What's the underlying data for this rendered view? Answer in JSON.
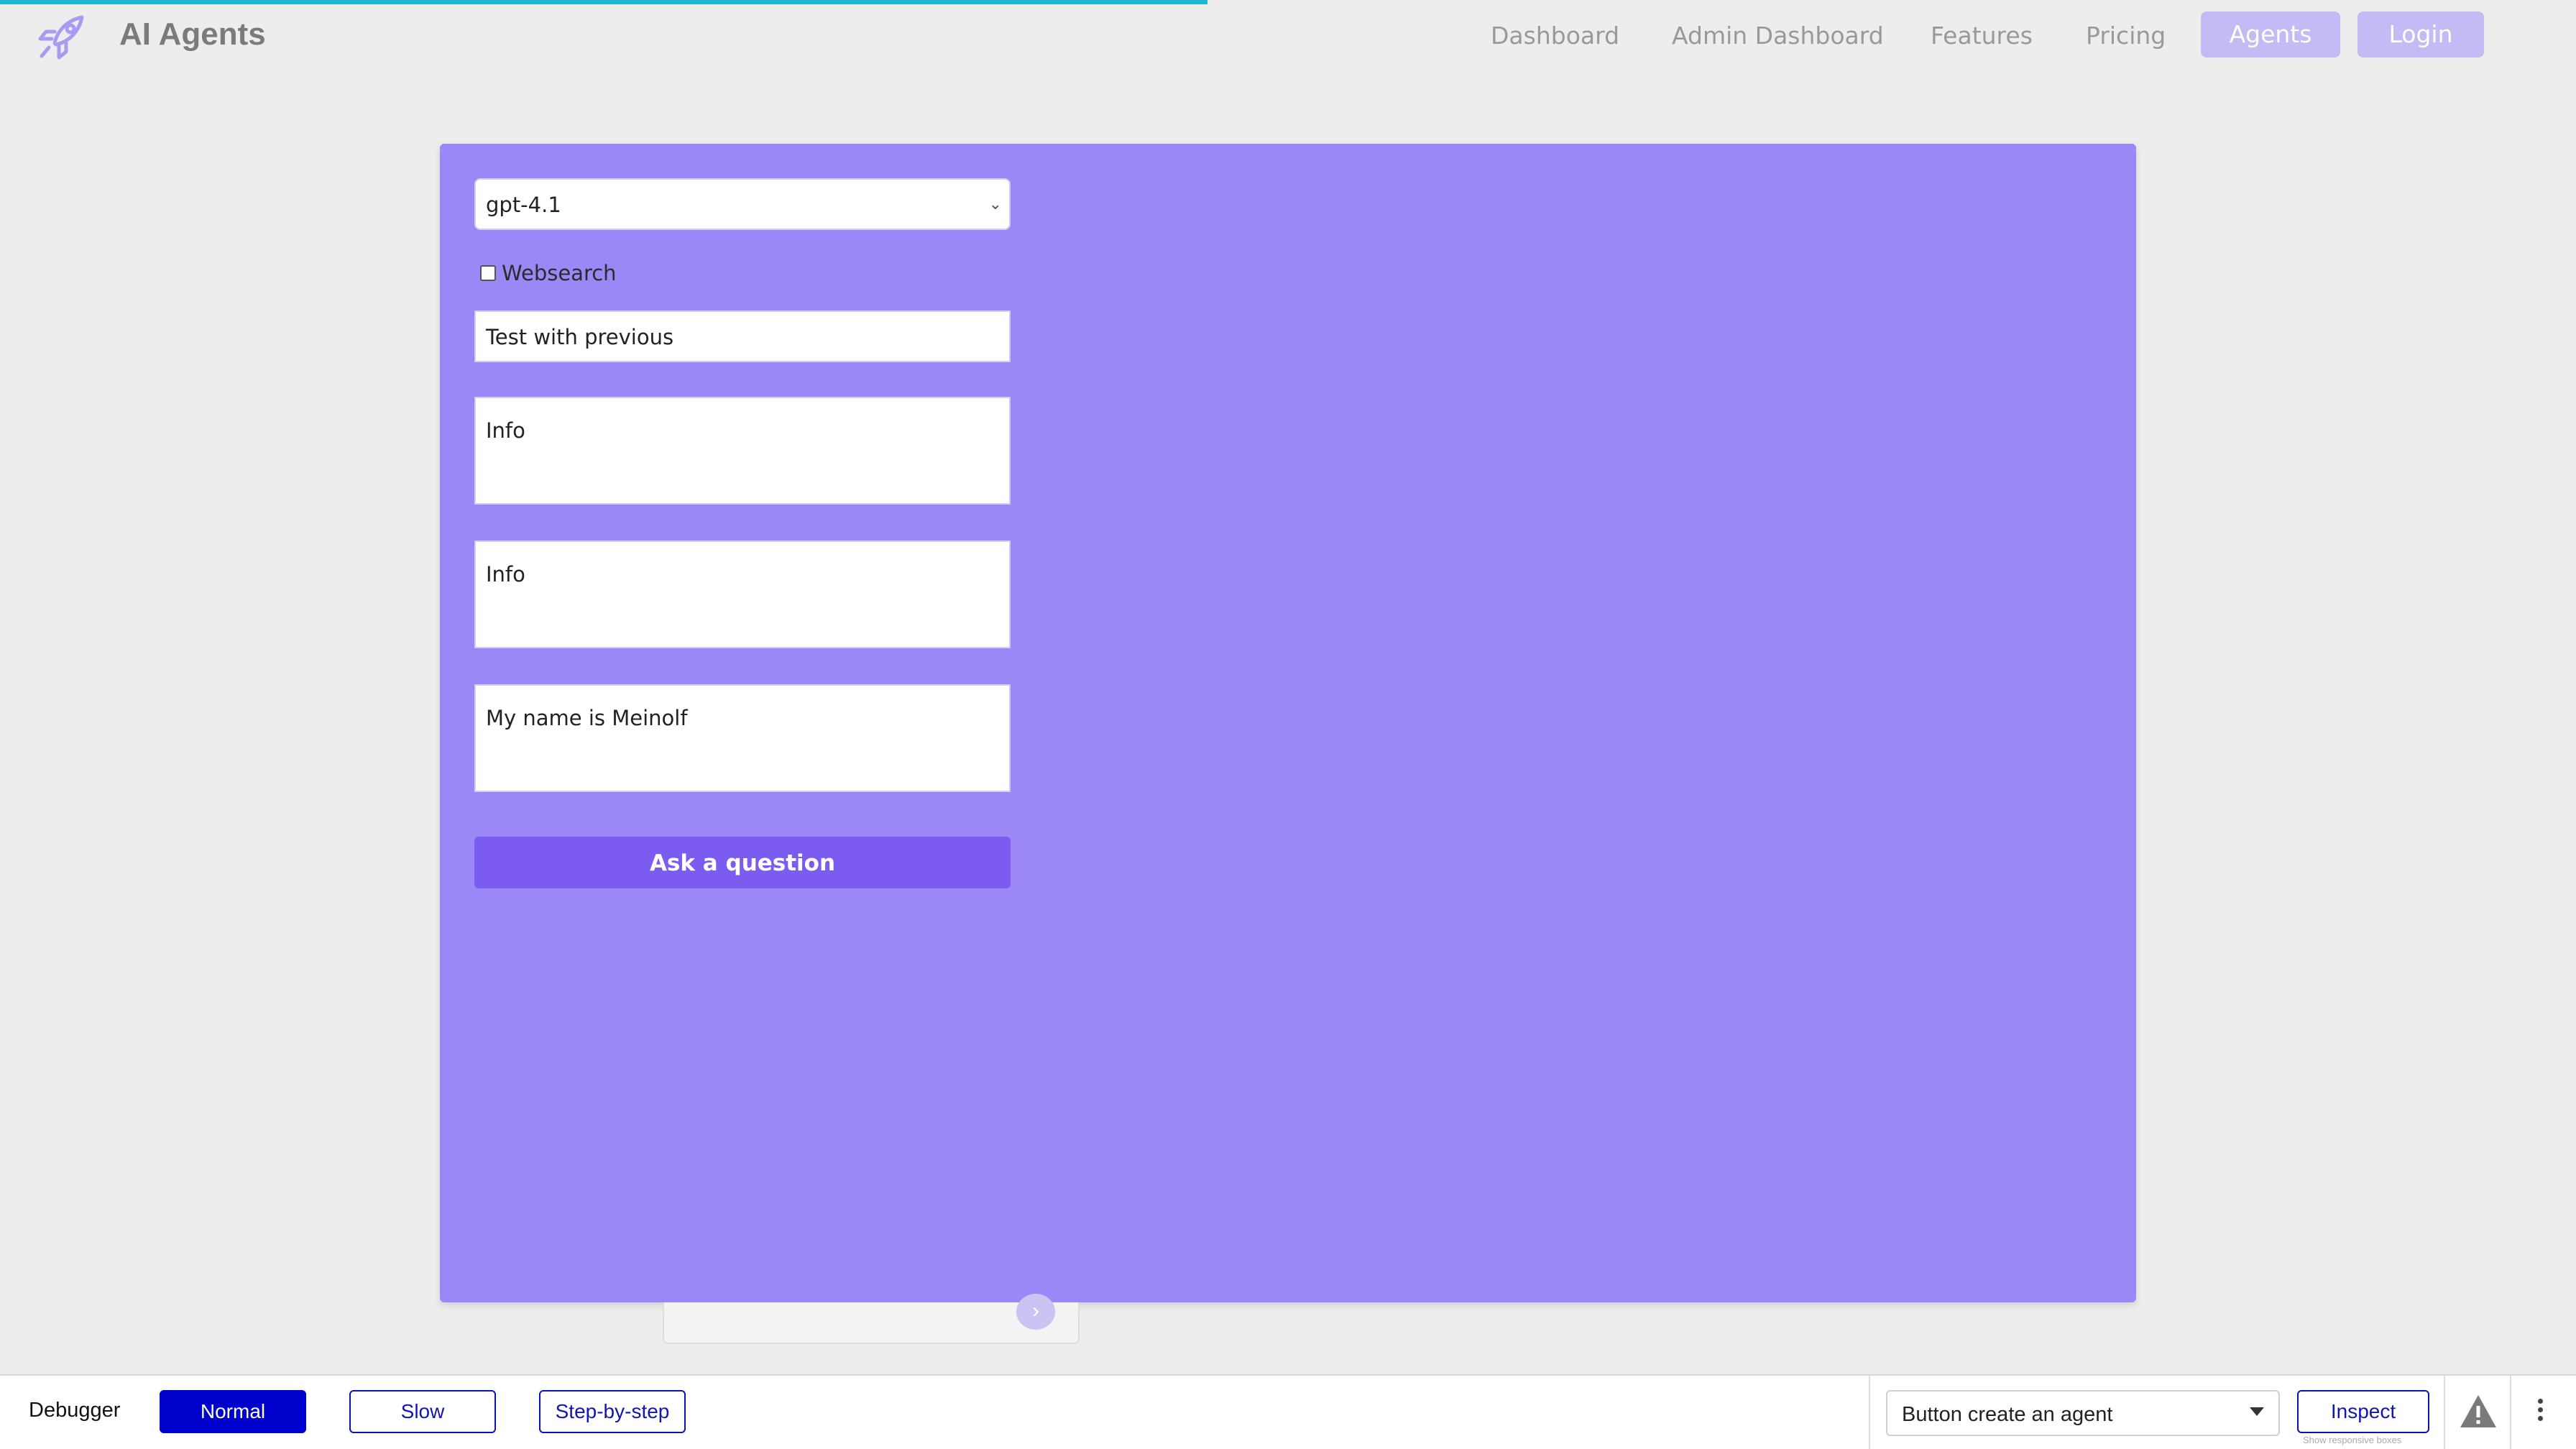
{
  "header": {
    "brand": "AI Agents",
    "logo_icon": "rocket-icon",
    "nav": [
      {
        "label": "Dashboard"
      },
      {
        "label": "Admin Dashboard"
      },
      {
        "label": "Features"
      },
      {
        "label": "Pricing"
      }
    ],
    "agents_label": "Agents",
    "login_label": "Login"
  },
  "form": {
    "model_select": "gpt-4.1",
    "websearch_label": "Websearch",
    "websearch_checked": false,
    "title_value": "Test with previous",
    "info_1": "Info",
    "info_2": "Info",
    "message": "My name is Meinolf",
    "ask_label": "Ask a question"
  },
  "debugger": {
    "label": "Debugger",
    "modes": [
      {
        "label": "Normal",
        "active": true
      },
      {
        "label": "Slow",
        "active": false
      },
      {
        "label": "Step-by-step",
        "active": false
      }
    ],
    "element_select": "Button create an agent",
    "inspect_label": "Inspect",
    "hint": "Show responsive boxes"
  },
  "colors": {
    "accent": "#9b87f5",
    "button": "#7c5cf0",
    "progress": "#1bb6cf"
  }
}
